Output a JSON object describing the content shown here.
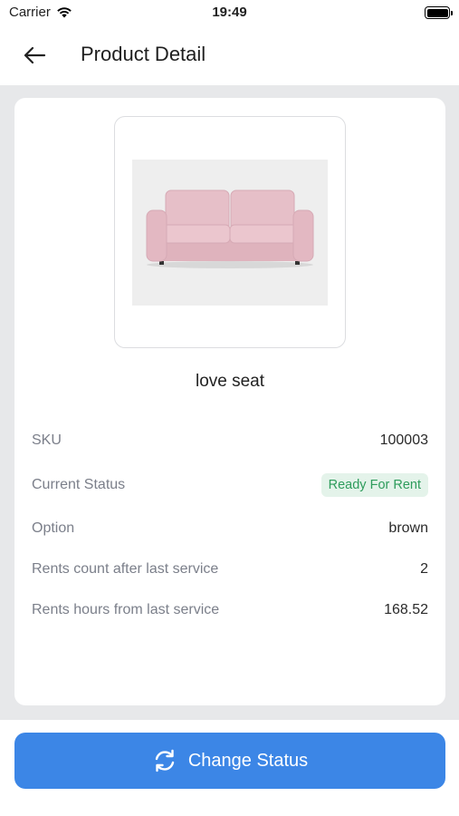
{
  "status_bar": {
    "carrier": "Carrier",
    "time": "19:49"
  },
  "header": {
    "title": "Product Detail"
  },
  "product": {
    "name": "love seat",
    "details": [
      {
        "label": "SKU",
        "value": "100003"
      },
      {
        "label": "Current Status",
        "value": "Ready For Rent"
      },
      {
        "label": "Option",
        "value": "brown"
      },
      {
        "label": "Rents count after last service",
        "value": "2"
      },
      {
        "label": "Rents hours from last service",
        "value": "168.52"
      }
    ]
  },
  "actions": {
    "change_status_label": "Change Status"
  },
  "colors": {
    "accent": "#3c86e6",
    "status_badge_bg": "#e4f3ea",
    "status_badge_text": "#2e9c5c",
    "sofa": "#e8c3cb"
  },
  "icons": [
    "wifi-icon",
    "battery-icon",
    "back-arrow-icon",
    "refresh-icon"
  ]
}
